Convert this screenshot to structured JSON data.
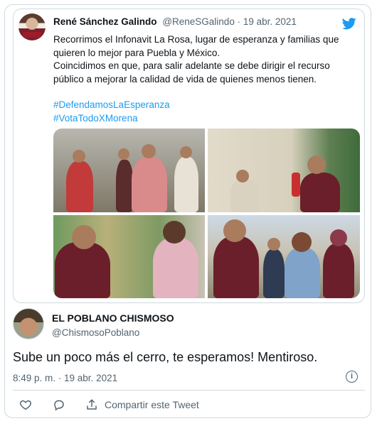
{
  "quoted_tweet": {
    "author_name": "René Sánchez Galindo",
    "meta": "@ReneSGalindo · 19 abr. 2021",
    "body_lines": [
      "Recorrimos el Infonavit La Rosa, lugar de esperanza y familias que",
      "quieren lo mejor para Puebla y México.",
      "Coincidimos en que, para salir adelante se debe dirigir el recurso",
      "público a mejorar la calidad de vida de quienes menos tienen."
    ],
    "hashtags": [
      "#DefendamosLaEsperanza",
      "#VotaTodoXMorena"
    ],
    "brand_icon": "twitter-bird-icon",
    "accent_color": "#1d9bf0"
  },
  "reply_tweet": {
    "author_name": "EL POBLANO CHISMOSO",
    "handle": "@ChismosoPoblano",
    "text": "Sube un poco más el cerro, te esperamos! Mentiroso.",
    "timestamp": "8:49 p. m. · 19 abr. 2021",
    "info_icon": "i"
  },
  "actions": {
    "like_icon": "heart-icon",
    "reply_icon": "comment-icon",
    "share_icon": "share-icon",
    "share_label": "Compartir este Tweet"
  }
}
